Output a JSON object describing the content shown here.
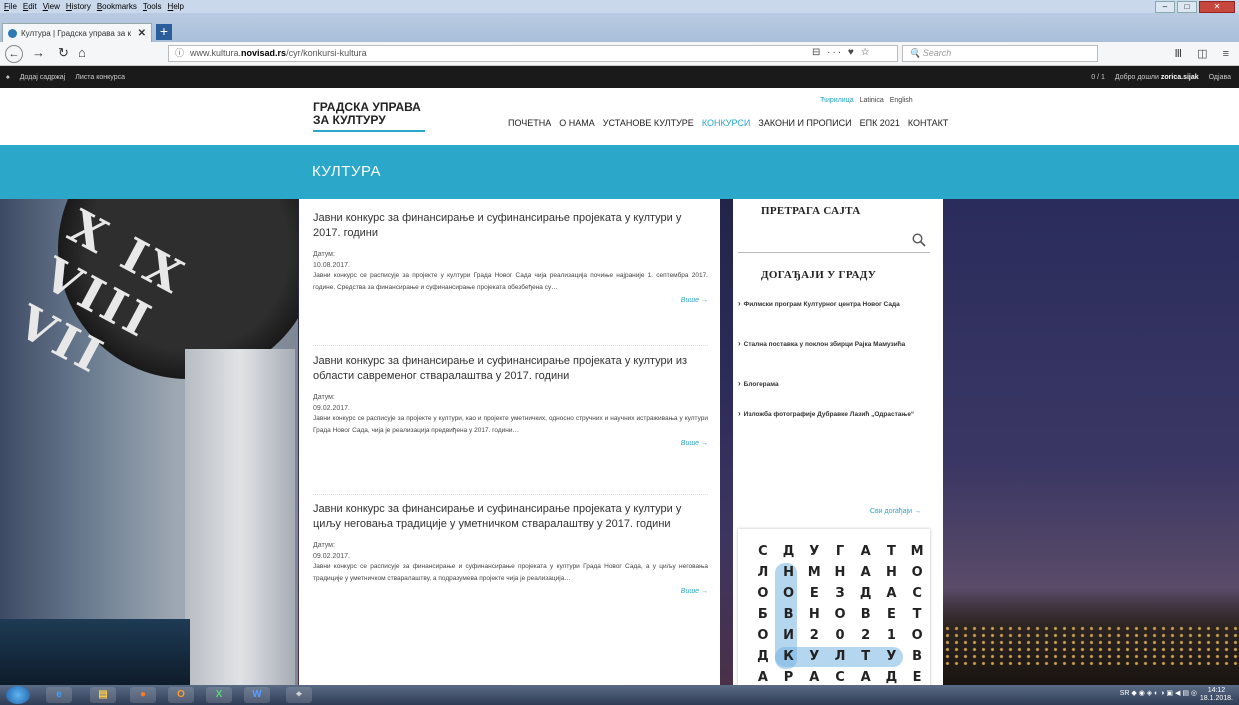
{
  "browser": {
    "menu": [
      "File",
      "Edit",
      "View",
      "History",
      "Bookmarks",
      "Tools",
      "Help"
    ],
    "tab_title": "Култура | Градска управа за к",
    "url_prefix": "www.kultura.",
    "url_domain": "novisad.rs",
    "url_path": "/cyr/konkursi-kultura",
    "search_placeholder": "Search",
    "page_actions": "⊟ ··· ♥ ☆",
    "toolbar_right": "Ⅲ ◫ ≡"
  },
  "adminbar": {
    "add_content": "Додај садржај",
    "contest_list": "Листа конкурса",
    "counter": "0 / 1",
    "welcome": "Добро дошли",
    "user": "zorica.sijak",
    "logout": "Одјава"
  },
  "header": {
    "site_title": "ГРАДСКА УПРАВА ЗА КУЛТУРУ",
    "languages": [
      {
        "label": "Ћирилица",
        "active": true
      },
      {
        "label": "Latinica",
        "active": false
      },
      {
        "label": "English",
        "active": false
      }
    ],
    "nav": [
      {
        "label": "ПОЧЕТНА",
        "active": false
      },
      {
        "label": "О НАМА",
        "active": false
      },
      {
        "label": "УСТАНОВЕ КУЛТУРЕ",
        "active": false
      },
      {
        "label": "КОНКУРСИ",
        "active": true
      },
      {
        "label": "ЗАКОНИ И ПРОПИСИ",
        "active": false
      },
      {
        "label": "ЕПК 2021",
        "active": false
      },
      {
        "label": "КОНТАКТ",
        "active": false
      }
    ]
  },
  "banner": {
    "title": "КУЛТУРА"
  },
  "articles": [
    {
      "title": "Јавни конкурс за финансирање и суфинансирање пројеката у култури у 2017. години",
      "date_label": "Датум:",
      "date": "10.08.2017.",
      "excerpt": "Јавни конкурс се расписује за пројекте у култури Града Новог Сада чија реализација почиње најраније 1. септембра 2017. године. Средства за финансирање и суфинансирање пројеката обезбеђена су…",
      "more": "Више →"
    },
    {
      "title": "Јавни конкурс за финансирање и суфинансирање пројеката у култури из области савременог стваралаштва у 2017. години",
      "date_label": "Датум:",
      "date": "09.02.2017.",
      "excerpt": "Јавни конкурс се расписује за пројекте у култури, као и пројекте уметничких, односно стручних и научних истраживања у култури Града Новог Сада, чија је реализација предвиђена у 2017. години…",
      "more": "Више →"
    },
    {
      "title": "Јавни конкурс за финансирање и суфинансирање пројеката у култури у циљу неговања традиције у уметничком стваралаштву у 2017. години",
      "date_label": "Датум:",
      "date": "09.02.2017.",
      "excerpt": "Јавни конкурс се расписује за финансирање и суфинансирање пројеката у култури Града Новог Сада, а у циљу неговања традиције у уметничком стваралаштву, а подразумева пројекте чија је реализација…",
      "more": "Више →"
    }
  ],
  "sidebar": {
    "search_title": "ПРЕТРАГА САЈТА",
    "events_title": "ДОГАЂАЈИ У ГРАДУ",
    "events": [
      "Филмски програм Културног центра Новог Сада",
      "Стална поставка у поклон збирци Рајка Мамузића",
      "Блогерама",
      "Изложба фотографије Дубравке Лазић „Одрастање“"
    ],
    "all_events": "Сви догађаји →",
    "word_grid": [
      [
        "С",
        "Д",
        "У",
        "Г",
        "А",
        "Т",
        "М"
      ],
      [
        "Л",
        "Н",
        "М",
        "Н",
        "А",
        "Н",
        "О"
      ],
      [
        "О",
        "О",
        "Е",
        "З",
        "Д",
        "А",
        "С"
      ],
      [
        "Б",
        "В",
        "Н",
        "О",
        "В",
        "Е",
        "Т"
      ],
      [
        "О",
        "И",
        "2",
        "0",
        "2",
        "1",
        "О"
      ],
      [
        "Д",
        "К",
        "У",
        "Л",
        "Т",
        "У",
        "В"
      ],
      [
        "А",
        "Р",
        "А",
        "С",
        "А",
        "Д",
        "Е"
      ]
    ]
  },
  "taskbar": {
    "apps": [
      "e",
      "▤",
      "●",
      "O",
      "X",
      "W",
      "⌖"
    ],
    "tray": "SR",
    "time": "14:12",
    "date": "18.1.2018."
  },
  "colors": {
    "accent": "#2aa7c9",
    "adminbar": "#1a1a1a"
  }
}
